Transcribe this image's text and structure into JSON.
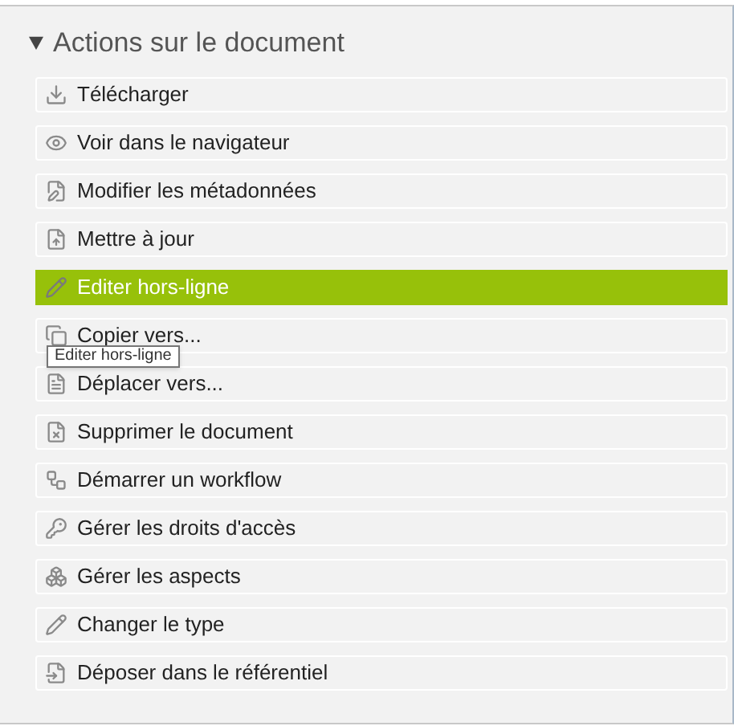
{
  "panel": {
    "title": "Actions sur le document",
    "expanded": true
  },
  "actions": [
    {
      "label": "Télécharger",
      "selected": false
    },
    {
      "label": "Voir dans le navigateur",
      "selected": false
    },
    {
      "label": "Modifier les métadonnées",
      "selected": false
    },
    {
      "label": "Mettre à jour",
      "selected": false
    },
    {
      "label": "Editer hors-ligne",
      "selected": true
    },
    {
      "label": "Copier vers...",
      "selected": false
    },
    {
      "label": "Déplacer vers...",
      "selected": false
    },
    {
      "label": "Supprimer le document",
      "selected": false
    },
    {
      "label": "Démarrer un workflow",
      "selected": false
    },
    {
      "label": "Gérer les droits d'accès",
      "selected": false
    },
    {
      "label": "Gérer les aspects",
      "selected": false
    },
    {
      "label": "Changer le type",
      "selected": false
    },
    {
      "label": "Déposer dans le référentiel",
      "selected": false
    }
  ],
  "tooltip": {
    "text": "Editer hors-ligne"
  }
}
